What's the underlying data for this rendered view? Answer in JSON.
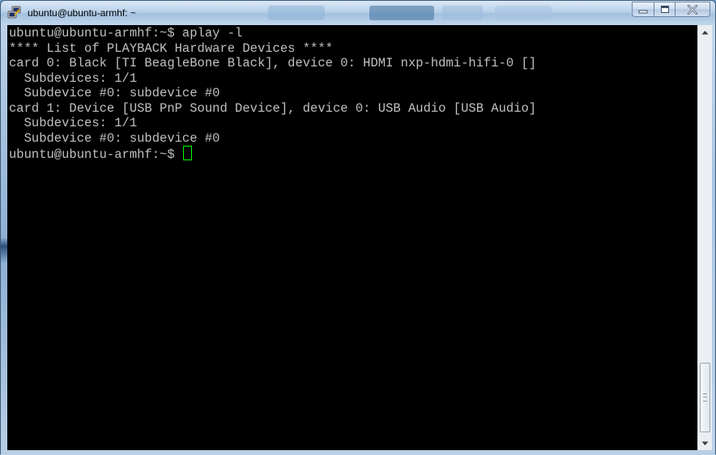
{
  "window": {
    "title": "ubuntu@ubuntu-armhf: ~",
    "icon": "putty-icon",
    "accent_color": "#b9d1ea"
  },
  "terminal": {
    "lines": [
      "ubuntu@ubuntu-armhf:~$ aplay -l",
      "**** List of PLAYBACK Hardware Devices ****",
      "card 0: Black [TI BeagleBone Black], device 0: HDMI nxp-hdmi-hifi-0 []",
      "  Subdevices: 1/1",
      "  Subdevice #0: subdevice #0",
      "card 1: Device [USB PnP Sound Device], device 0: USB Audio [USB Audio]",
      "  Subdevices: 1/1",
      "  Subdevice #0: subdevice #0"
    ],
    "prompt": "ubuntu@ubuntu-armhf:~$ ",
    "text_color": "#c0c0c0",
    "background_color": "#000000",
    "cursor_color": "#00ff00"
  }
}
